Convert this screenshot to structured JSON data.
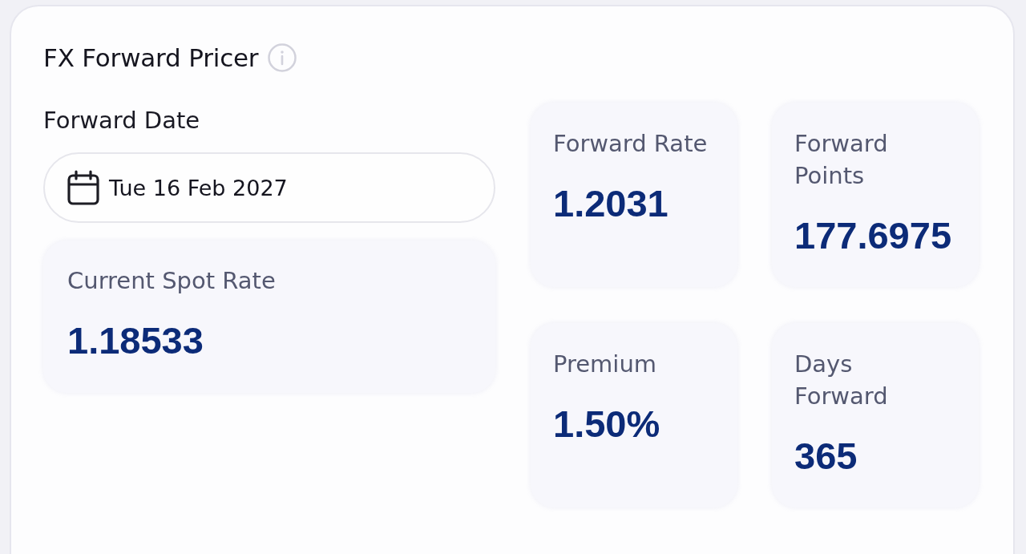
{
  "panel": {
    "title": "FX Forward Pricer"
  },
  "forward_date": {
    "label": "Forward Date",
    "value": "Tue 16 Feb 2027"
  },
  "spot_rate": {
    "label": "Current Spot Rate",
    "value": "1.18533"
  },
  "metrics": [
    {
      "label": "Forward Rate",
      "value": "1.2031"
    },
    {
      "label": "Forward Points",
      "value": "177.6975"
    },
    {
      "label": "Premium",
      "value": "1.50%"
    },
    {
      "label": "Days Forward",
      "value": "365"
    }
  ]
}
